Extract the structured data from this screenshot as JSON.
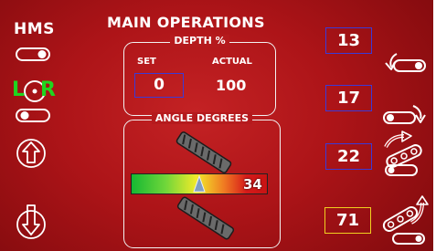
{
  "header": {
    "hms_label": "HMS",
    "title": "MAIN OPERATIONS"
  },
  "left_controls": {
    "lr_left": "L",
    "lr_right": "R",
    "lr_colors": {
      "left": "#1fd61f",
      "right": "#1fd61f"
    }
  },
  "depth": {
    "title": "DEPTH %",
    "set_label": "SET",
    "actual_label": "ACTUAL",
    "set_value": "0",
    "actual_value": "100"
  },
  "angle": {
    "title": "ANGLE DEGREES",
    "value": "34",
    "gauge_indicator_fraction": 0.5
  },
  "right_values": [
    {
      "value": "13",
      "icon": "track-tilt-left-icon"
    },
    {
      "value": "17",
      "icon": "track-tilt-right-icon"
    },
    {
      "value": "22",
      "icon": "track-raise-icon"
    },
    {
      "value": "71",
      "icon": "track-raise-max-icon",
      "highlight": "#f0d020"
    }
  ],
  "colors": {
    "background": "#b51a1d",
    "value_box_border": "#3a3ad8",
    "highlight_border": "#f0d020"
  }
}
